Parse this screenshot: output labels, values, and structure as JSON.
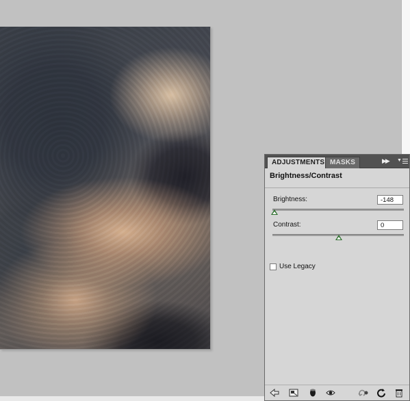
{
  "panel": {
    "tabs": [
      {
        "label": "ADJUSTMENTS",
        "active": true
      },
      {
        "label": "MASKS",
        "active": false
      }
    ],
    "title": "Brightness/Contrast",
    "brightness": {
      "label": "Brightness:",
      "value": "-148"
    },
    "contrast": {
      "label": "Contrast:",
      "value": "0"
    },
    "use_legacy": {
      "label": "Use Legacy",
      "checked": false
    },
    "footer_icons": [
      "back-arrow-icon",
      "expand-view-icon",
      "layer-clip-icon",
      "visibility-eye-icon",
      "previous-state-icon",
      "reset-icon",
      "trash-icon"
    ]
  },
  "canvas": {
    "image": "cloudy-sky-photo"
  },
  "colors": {
    "tabbar": "#525252",
    "panel_bg": "#d6d6d6",
    "workspace": "#c1c1c1",
    "slider_thumb": "#2d6f2d"
  }
}
